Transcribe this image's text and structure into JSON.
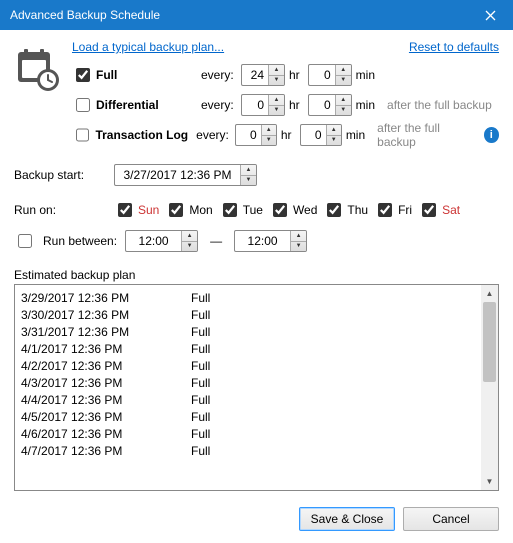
{
  "window": {
    "title": "Advanced Backup Schedule"
  },
  "links": {
    "load_plan": "Load a typical backup plan...",
    "reset": "Reset to defaults"
  },
  "labels": {
    "full": "Full",
    "differential": "Differential",
    "txlog": "Transaction Log",
    "every": "every:",
    "hr": "hr",
    "min": "min",
    "after_full": "after the full backup",
    "backup_start": "Backup start:",
    "run_on": "Run on:",
    "run_between": "Run between:",
    "dash": "—",
    "estimated": "Estimated backup plan",
    "save": "Save & Close",
    "cancel": "Cancel"
  },
  "schedule": {
    "full": {
      "checked": true,
      "hr": "24",
      "min": "0"
    },
    "differential": {
      "checked": false,
      "hr": "0",
      "min": "0"
    },
    "txlog": {
      "checked": false,
      "hr": "0",
      "min": "0"
    }
  },
  "backup_start": "3/27/2017 12:36 PM",
  "days": [
    {
      "label": "Sun",
      "checked": true,
      "weekend": true
    },
    {
      "label": "Mon",
      "checked": true,
      "weekend": false
    },
    {
      "label": "Tue",
      "checked": true,
      "weekend": false
    },
    {
      "label": "Wed",
      "checked": true,
      "weekend": false
    },
    {
      "label": "Thu",
      "checked": true,
      "weekend": false
    },
    {
      "label": "Fri",
      "checked": true,
      "weekend": false
    },
    {
      "label": "Sat",
      "checked": true,
      "weekend": true
    }
  ],
  "run_between": {
    "checked": false,
    "from": "12:00 PM",
    "to": "12:00 PM"
  },
  "plan": [
    {
      "time": "3/29/2017 12:36 PM",
      "type": "Full"
    },
    {
      "time": "3/30/2017 12:36 PM",
      "type": "Full"
    },
    {
      "time": "3/31/2017 12:36 PM",
      "type": "Full"
    },
    {
      "time": "4/1/2017 12:36 PM",
      "type": "Full"
    },
    {
      "time": "4/2/2017 12:36 PM",
      "type": "Full"
    },
    {
      "time": "4/3/2017 12:36 PM",
      "type": "Full"
    },
    {
      "time": "4/4/2017 12:36 PM",
      "type": "Full"
    },
    {
      "time": "4/5/2017 12:36 PM",
      "type": "Full"
    },
    {
      "time": "4/6/2017 12:36 PM",
      "type": "Full"
    },
    {
      "time": "4/7/2017 12:36 PM",
      "type": "Full"
    }
  ]
}
